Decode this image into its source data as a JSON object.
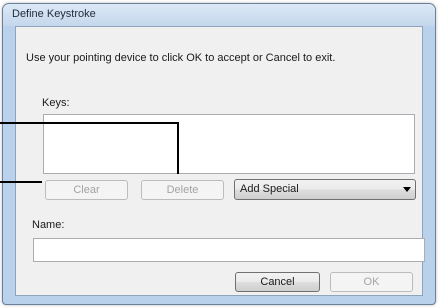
{
  "dialog": {
    "title": "Define Keystroke",
    "instruction": "Use your pointing device to click OK to accept or Cancel to exit.",
    "keys_label": "Keys:",
    "keys_value": "",
    "clear_label": "Clear",
    "delete_label": "Delete",
    "add_special": {
      "selected": "Add Special"
    },
    "name_label": "Name:",
    "name_value": "",
    "cancel_label": "Cancel",
    "ok_label": "OK"
  },
  "colors": {
    "frame": "#b9d1ea",
    "client_background": "#f0f0f0",
    "disabled_text": "#a3a3a3",
    "callout_line": "#000000"
  }
}
